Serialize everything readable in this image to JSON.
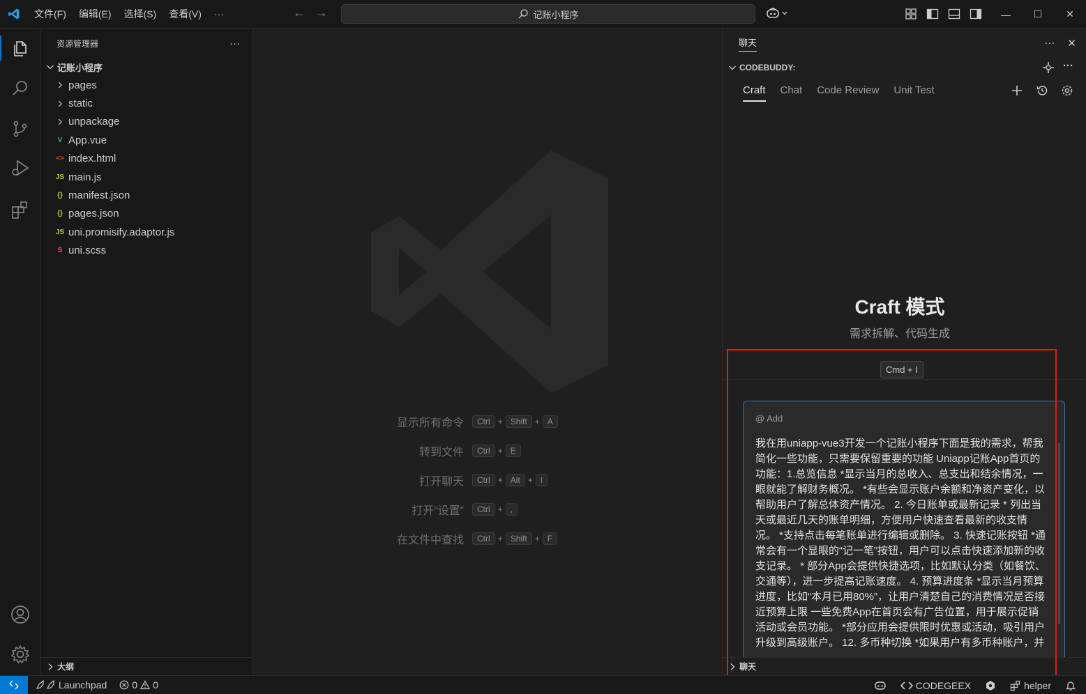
{
  "titlebar": {
    "menus": [
      "文件(F)",
      "编辑(E)",
      "选择(S)",
      "查看(V)",
      "···"
    ],
    "search_text": "记账小程序"
  },
  "sidebar": {
    "title": "资源管理器",
    "more": "···",
    "root": "记账小程序",
    "items": [
      {
        "label": "pages",
        "type": "folder",
        "icon": "chevron-right-icon"
      },
      {
        "label": "static",
        "type": "folder",
        "icon": "chevron-right-icon"
      },
      {
        "label": "unpackage",
        "type": "folder",
        "icon": "chevron-right-icon"
      },
      {
        "label": "App.vue",
        "type": "file",
        "icon": "vue-icon",
        "badge": "V",
        "color": "#41b883"
      },
      {
        "label": "index.html",
        "type": "file",
        "icon": "html-icon",
        "badge": "<>",
        "color": "#e44d26"
      },
      {
        "label": "main.js",
        "type": "file",
        "icon": "js-icon",
        "badge": "JS",
        "color": "#cbcb41"
      },
      {
        "label": "manifest.json",
        "type": "file",
        "icon": "json-icon",
        "badge": "{}",
        "color": "#cbcb41"
      },
      {
        "label": "pages.json",
        "type": "file",
        "icon": "json-icon",
        "badge": "{}",
        "color": "#cbcb41"
      },
      {
        "label": "uni.promisify.adaptor.js",
        "type": "file",
        "icon": "js-icon",
        "badge": "JS",
        "color": "#cbcb41"
      },
      {
        "label": "uni.scss",
        "type": "file",
        "icon": "sass-icon",
        "badge": "S",
        "color": "#f55385"
      }
    ],
    "outline": "大纲"
  },
  "editor": {
    "shortcuts": [
      {
        "label": "显示所有命令",
        "keys": [
          "Ctrl",
          "Shift",
          "A"
        ]
      },
      {
        "label": "转到文件",
        "keys": [
          "Ctrl",
          "E"
        ]
      },
      {
        "label": "打开聊天",
        "keys": [
          "Ctrl",
          "Alt",
          "I"
        ]
      },
      {
        "label": "打开“设置”",
        "keys": [
          "Ctrl",
          ","
        ]
      },
      {
        "label": "在文件中查找",
        "keys": [
          "Ctrl",
          "Shift",
          "F"
        ]
      }
    ]
  },
  "panel": {
    "tab": "聊天",
    "section": "CODEBUDDY:",
    "tabs": [
      "Craft",
      "Chat",
      "Code Review",
      "Unit Test"
    ],
    "active_tab": "Craft",
    "craft_title": "Craft 模式",
    "craft_sub": "需求拆解、代码生成",
    "cmd_badge": "Cmd + I",
    "add_ref": "@ Add",
    "prompt": "我在用uniapp-vue3开发一个记账小程序下面是我的需求，帮我简化一些功能，只需要保留重要的功能 Uniapp记账App首页的功能：1.总览信息 *显示当月的总收入、总支出和结余情况，一眼就能了解财务概况。 *有些会显示账户余额和净资产变化，以帮助用户了解总体资产情况。 2. 今日账单或最新记录 * 列出当天或最近几天的账单明细，方便用户快速查看最新的收支情况。 *支持点击每笔账单进行编辑或删除。 3. 快速记账按钮 *通常会有一个显眼的“记一笔”按钮，用户可以点击快速添加新的收支记录。 * 部分App会提供快捷选项，比如默认分类（如餐饮、交通等），进一步提高记账速度。 4. 预算进度条 *显示当月预算进度，比如“本月已用80%”，让用户清楚自己的消费情况是否接近预算上限 一些免费App在首页会有广告位置，用于展示促销活动或会员功能。 *部分应用会提供限时优惠或活动，吸引用户升级到高级账户。 12. 多币种切换 *如果用户有多币种账户，并",
    "footer": "聊天"
  },
  "statusbar": {
    "launchpad": "Launchpad",
    "errors": "0",
    "warnings": "0",
    "codegeex": "CODEGEEX",
    "helper": "helper"
  },
  "colors": {
    "accent": "#0078d4",
    "highlight_box": "#e11a1a"
  }
}
